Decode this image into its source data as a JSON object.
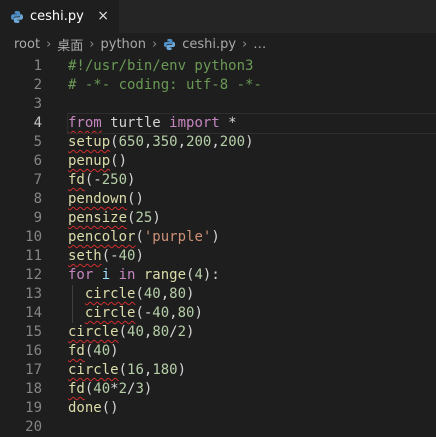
{
  "tab": {
    "filename": "ceshi.py",
    "close_glyph": "×",
    "icon": "python-icon"
  },
  "breadcrumb": {
    "items": [
      "root",
      "桌面",
      "python"
    ],
    "file": "ceshi.py",
    "ellipsis": "…",
    "separator": "›"
  },
  "editor": {
    "current_line": 4,
    "lines": [
      {
        "n": "1",
        "tokens": [
          [
            "cm",
            "#!/usr/bin/env python3"
          ]
        ]
      },
      {
        "n": "2",
        "tokens": [
          [
            "cm",
            "# -*- coding: utf-8 -*-"
          ]
        ]
      },
      {
        "n": "3",
        "tokens": []
      },
      {
        "n": "4",
        "tokens": [
          [
            "kw sq",
            "from"
          ],
          [
            "",
            " turtle "
          ],
          [
            "kw",
            "import"
          ],
          [
            "",
            " *"
          ]
        ]
      },
      {
        "n": "5",
        "tokens": [
          [
            "fn sq",
            "setup"
          ],
          [
            "",
            "("
          ],
          [
            "num",
            "650"
          ],
          [
            "",
            ","
          ],
          [
            "num",
            "350"
          ],
          [
            "",
            ","
          ],
          [
            "num",
            "200"
          ],
          [
            "",
            ","
          ],
          [
            "num",
            "200"
          ],
          [
            "",
            ")"
          ]
        ]
      },
      {
        "n": "6",
        "tokens": [
          [
            "fn sq",
            "penup"
          ],
          [
            "",
            "()"
          ]
        ]
      },
      {
        "n": "7",
        "tokens": [
          [
            "fn sq",
            "fd"
          ],
          [
            "",
            "(-"
          ],
          [
            "num",
            "250"
          ],
          [
            "",
            ")"
          ]
        ]
      },
      {
        "n": "8",
        "tokens": [
          [
            "fn sq",
            "pendown"
          ],
          [
            "",
            "()"
          ]
        ]
      },
      {
        "n": "9",
        "tokens": [
          [
            "fn sq",
            "pensize"
          ],
          [
            "",
            "("
          ],
          [
            "num",
            "25"
          ],
          [
            "",
            ")"
          ]
        ]
      },
      {
        "n": "10",
        "tokens": [
          [
            "fn sq",
            "pencolor"
          ],
          [
            "",
            "("
          ],
          [
            "str",
            "'purple'"
          ],
          [
            "",
            ")"
          ]
        ]
      },
      {
        "n": "11",
        "tokens": [
          [
            "fn sq",
            "seth"
          ],
          [
            "",
            "(-"
          ],
          [
            "num",
            "40"
          ],
          [
            "",
            ")"
          ]
        ]
      },
      {
        "n": "12",
        "tokens": [
          [
            "kw",
            "for"
          ],
          [
            "",
            ""
          ],
          [
            "var",
            " i "
          ],
          [
            "kw",
            "in"
          ],
          [
            "",
            ""
          ],
          [
            "fn",
            " range"
          ],
          [
            "",
            "("
          ],
          [
            "num",
            "4"
          ],
          [
            "",
            "):"
          ]
        ]
      },
      {
        "n": "13",
        "tokens": [
          [
            "",
            "  "
          ],
          [
            "fn sq",
            "circle"
          ],
          [
            "",
            "("
          ],
          [
            "num",
            "40"
          ],
          [
            "",
            ","
          ],
          [
            "num",
            "80"
          ],
          [
            "",
            ")"
          ]
        ]
      },
      {
        "n": "14",
        "tokens": [
          [
            "",
            "  "
          ],
          [
            "fn sq",
            "circle"
          ],
          [
            "",
            "(-"
          ],
          [
            "num",
            "40"
          ],
          [
            "",
            ","
          ],
          [
            "num",
            "80"
          ],
          [
            "",
            ")"
          ]
        ]
      },
      {
        "n": "15",
        "tokens": [
          [
            "fn sq",
            "circle"
          ],
          [
            "",
            "("
          ],
          [
            "num",
            "40"
          ],
          [
            "",
            ","
          ],
          [
            "num",
            "80"
          ],
          [
            "",
            "/"
          ],
          [
            "num",
            "2"
          ],
          [
            "",
            ")"
          ]
        ]
      },
      {
        "n": "16",
        "tokens": [
          [
            "fn sq",
            "fd"
          ],
          [
            "",
            "("
          ],
          [
            "num",
            "40"
          ],
          [
            "",
            ")"
          ]
        ]
      },
      {
        "n": "17",
        "tokens": [
          [
            "fn sq",
            "circle"
          ],
          [
            "",
            "("
          ],
          [
            "num",
            "16"
          ],
          [
            "",
            ","
          ],
          [
            "num",
            "180"
          ],
          [
            "",
            ")"
          ]
        ]
      },
      {
        "n": "18",
        "tokens": [
          [
            "fn sq",
            "fd"
          ],
          [
            "",
            "("
          ],
          [
            "num",
            "40"
          ],
          [
            "",
            "*"
          ],
          [
            "num",
            "2"
          ],
          [
            "",
            "/"
          ],
          [
            "num",
            "3"
          ],
          [
            "",
            ")"
          ]
        ]
      },
      {
        "n": "19",
        "tokens": [
          [
            "fn",
            "done"
          ],
          [
            "",
            "()"
          ]
        ]
      },
      {
        "n": "20",
        "tokens": []
      }
    ]
  }
}
